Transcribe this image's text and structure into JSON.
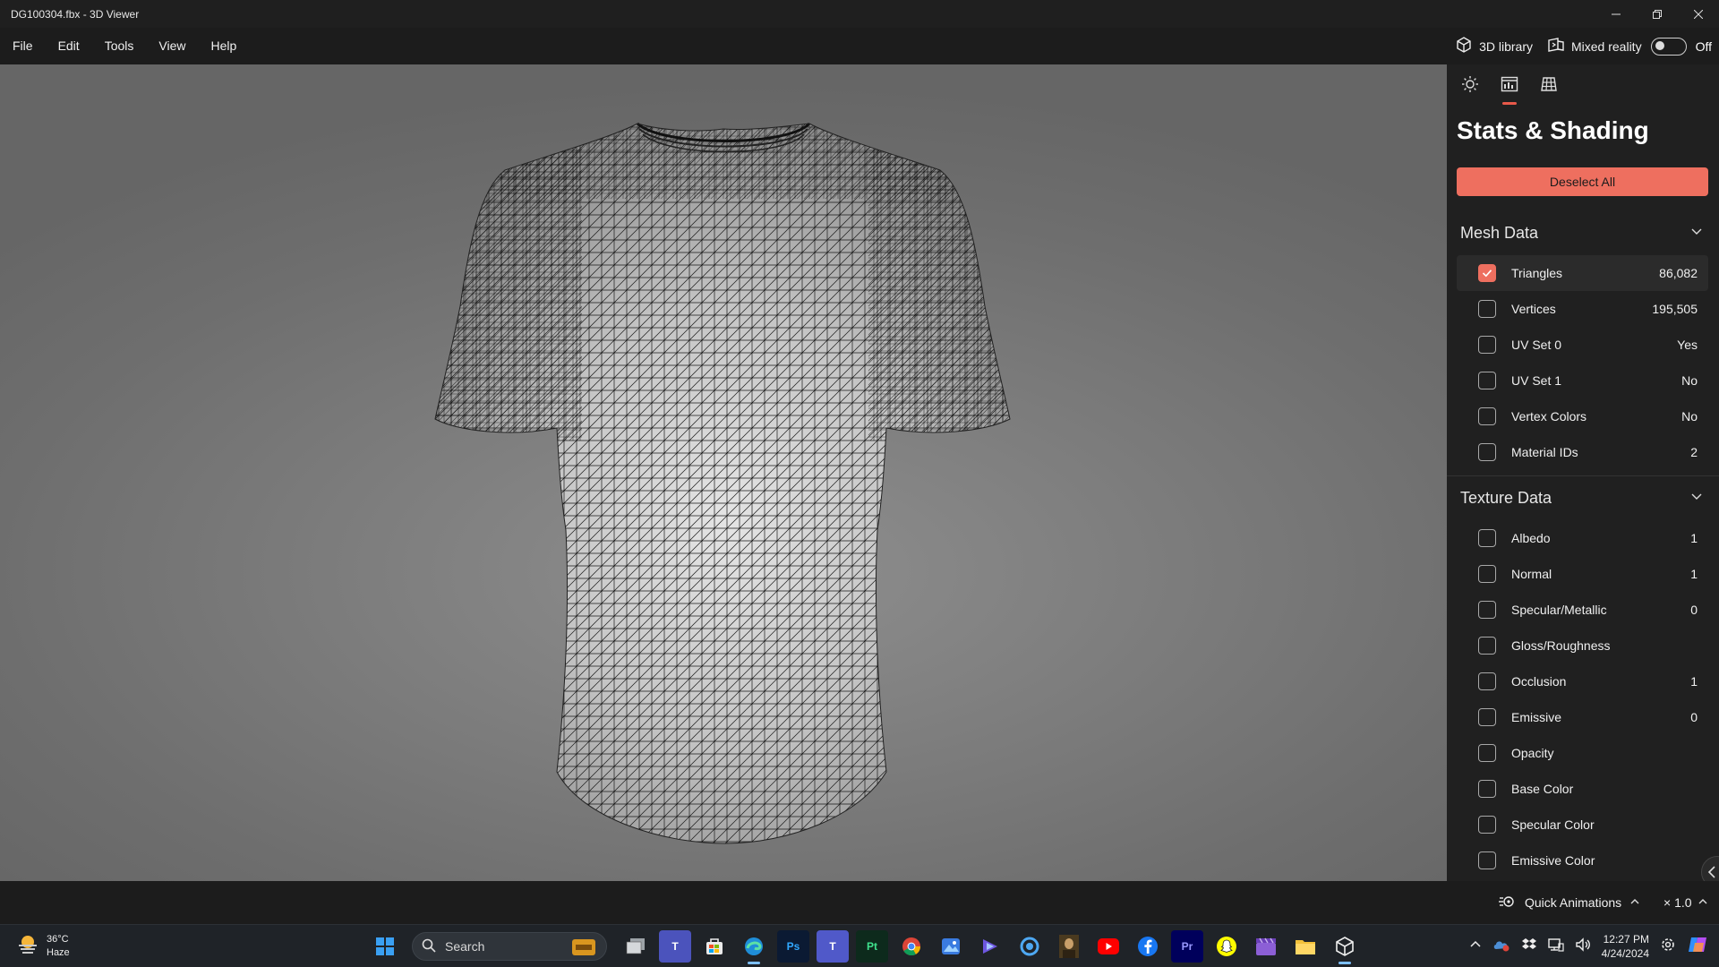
{
  "window": {
    "title": "DG100304.fbx - 3D Viewer"
  },
  "menu": {
    "items": [
      "File",
      "Edit",
      "Tools",
      "View",
      "Help"
    ]
  },
  "topbar": {
    "library_label": "3D library",
    "mixed_reality_label": "Mixed reality",
    "toggle_state": "Off"
  },
  "panel": {
    "title": "Stats & Shading",
    "deselect_label": "Deselect All",
    "mesh_section": "Mesh Data",
    "mesh_rows": [
      {
        "label": "Triangles",
        "value": "86,082",
        "checked": true
      },
      {
        "label": "Vertices",
        "value": "195,505",
        "checked": false
      },
      {
        "label": "UV Set 0",
        "value": "Yes",
        "checked": false
      },
      {
        "label": "UV Set 1",
        "value": "No",
        "checked": false
      },
      {
        "label": "Vertex Colors",
        "value": "No",
        "checked": false
      },
      {
        "label": "Material IDs",
        "value": "2",
        "checked": false
      }
    ],
    "texture_section": "Texture Data",
    "texture_rows": [
      {
        "label": "Albedo",
        "value": "1",
        "checked": false
      },
      {
        "label": "Normal",
        "value": "1",
        "checked": false
      },
      {
        "label": "Specular/Metallic",
        "value": "0",
        "checked": false
      },
      {
        "label": "Gloss/Roughness",
        "value": "",
        "checked": false
      },
      {
        "label": "Occlusion",
        "value": "1",
        "checked": false
      },
      {
        "label": "Emissive",
        "value": "0",
        "checked": false
      },
      {
        "label": "Opacity",
        "value": "",
        "checked": false
      },
      {
        "label": "Base Color",
        "value": "",
        "checked": false
      },
      {
        "label": "Specular Color",
        "value": "",
        "checked": false
      },
      {
        "label": "Emissive Color",
        "value": "",
        "checked": false
      }
    ]
  },
  "status": {
    "quick_animations": "Quick Animations",
    "zoom": "× 1.0"
  },
  "taskbar": {
    "temperature": "36°C",
    "condition": "Haze",
    "search_placeholder": "Search",
    "time": "12:27 PM",
    "date": "4/24/2024"
  },
  "colors": {
    "accent": "#ee6f5f",
    "panel_bg": "#202020",
    "viewport_bg": "#7a7a7a"
  }
}
